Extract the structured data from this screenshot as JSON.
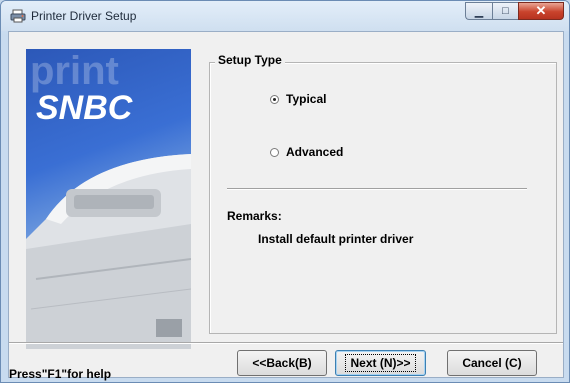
{
  "window": {
    "title": "Printer Driver Setup",
    "icon": "printer-icon",
    "min_symbol": "▁",
    "max_symbol": "□",
    "close_symbol": "✕"
  },
  "banner": {
    "logo": "SNBC",
    "watermark": "print"
  },
  "setup_type": {
    "legend": "Setup Type",
    "options": [
      {
        "label": "Typical",
        "selected": true
      },
      {
        "label": "Advanced",
        "selected": false
      }
    ]
  },
  "remarks": {
    "label": "Remarks:",
    "text": "Install default printer driver"
  },
  "footer": {
    "help_text": "Press\"F1\"for help",
    "back_label": "<<Back(B)",
    "next_label": "Next (N)>>",
    "cancel_label": "Cancel (C)"
  }
}
